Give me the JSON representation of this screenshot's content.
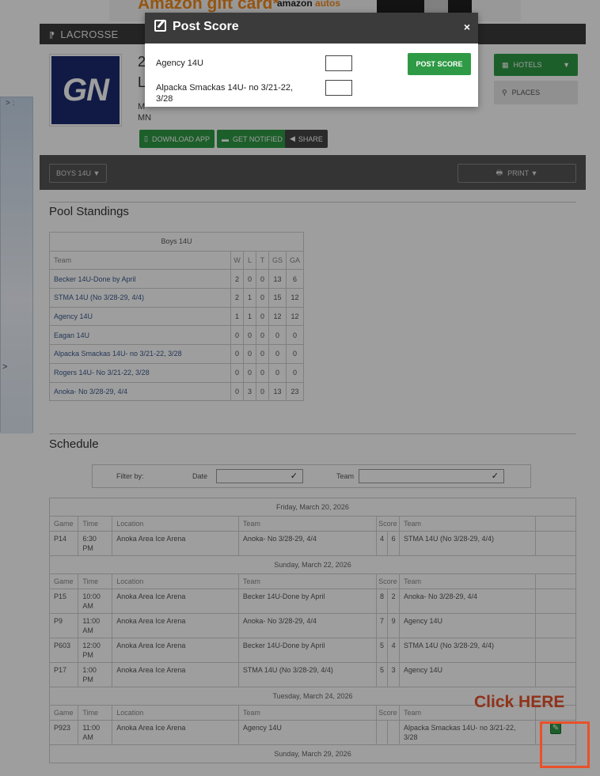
{
  "ad": {
    "brand": "Amazon gift card*",
    "sub_prefix": "amazon",
    "sub_suffix": "autos"
  },
  "sidebar_left": {
    "mark": "> :",
    "arrow": ">"
  },
  "header": {
    "title": "LACROSSE"
  },
  "team_info": {
    "logo_text": "GN",
    "name_line1": "2",
    "name_line2": "L",
    "location_line1": "M",
    "location_line2": "MN",
    "download_label": "DOWNLOAD APP",
    "notify_label": "GET NOTIFIED",
    "share_label": "SHARE",
    "hotels_label": "HOTELS",
    "places_label": "PLACES"
  },
  "toolbar": {
    "division_label": "BOYS 14U ▼",
    "print_label": "PRINT ▼"
  },
  "pool": {
    "title": "Pool Standings",
    "group": "Boys 14U",
    "columns": [
      "Team",
      "W",
      "L",
      "T",
      "GS",
      "GA"
    ],
    "rows": [
      [
        "Becker 14U-Done by April",
        "2",
        "0",
        "0",
        "13",
        "6"
      ],
      [
        "STMA 14U (No 3/28-29, 4/4)",
        "2",
        "1",
        "0",
        "15",
        "12"
      ],
      [
        "Agency 14U",
        "1",
        "1",
        "0",
        "12",
        "12"
      ],
      [
        "Eagan 14U",
        "0",
        "0",
        "0",
        "0",
        "0"
      ],
      [
        "Alpacka Smackas 14U- no 3/21-22, 3/28",
        "0",
        "0",
        "0",
        "0",
        "0"
      ],
      [
        "Rogers 14U- No 3/21-22, 3/28",
        "0",
        "0",
        "0",
        "0",
        "0"
      ],
      [
        "Anoka- No 3/28-29, 4/4",
        "0",
        "3",
        "0",
        "13",
        "23"
      ]
    ]
  },
  "schedule": {
    "title": "Schedule",
    "filter_by": "Filter by:",
    "date_label": "Date",
    "team_label": "Team",
    "columns": [
      "Game",
      "Time",
      "Location",
      "Team",
      "Score",
      "Team"
    ],
    "days": [
      {
        "date": "Friday, March 20, 2026",
        "games": [
          {
            "game": "P14",
            "time": "6:30 PM",
            "location": "Anoka Area Ice Arena",
            "home": "Anoka- No 3/28-29, 4/4",
            "s1": "4",
            "s2": "6",
            "away": "STMA 14U (No 3/28-29, 4/4)"
          }
        ]
      },
      {
        "date": "Sunday, March 22, 2026",
        "games": [
          {
            "game": "P15",
            "time": "10:00 AM",
            "location": "Anoka Area Ice Arena",
            "home": "Becker 14U-Done by April",
            "s1": "8",
            "s2": "2",
            "away": "Anoka- No 3/28-29, 4/4"
          },
          {
            "game": "P9",
            "time": "11:00 AM",
            "location": "Anoka Area Ice Arena",
            "home": "Anoka- No 3/28-29, 4/4",
            "s1": "7",
            "s2": "9",
            "away": "Agency 14U"
          },
          {
            "game": "P603",
            "time": "12:00 PM",
            "location": "Anoka Area Ice Arena",
            "home": "Becker 14U-Done by April",
            "s1": "5",
            "s2": "4",
            "away": "STMA 14U (No 3/28-29, 4/4)"
          },
          {
            "game": "P17",
            "time": "1:00 PM",
            "location": "Anoka Area Ice Arena",
            "home": "STMA 14U (No 3/28-29, 4/4)",
            "s1": "5",
            "s2": "3",
            "away": "Agency 14U"
          }
        ]
      },
      {
        "date": "Tuesday, March 24, 2026",
        "games": [
          {
            "game": "P923",
            "time": "11:00 AM",
            "location": "Anoka Area Ice Arena",
            "home": "Agency 14U",
            "s1": "",
            "s2": "",
            "away": "Alpacka Smackas 14U- no 3/21-22, 3/28",
            "edit": true
          }
        ]
      },
      {
        "date": "Sunday, March 29, 2026",
        "games": []
      }
    ]
  },
  "callout": {
    "text": "Click HERE"
  },
  "modal": {
    "title": "Post Score",
    "close": "×",
    "team1": "Agency 14U",
    "team2": "Alpacka Smackas 14U- no 3/21-22, 3/28",
    "submit_label": "POST SCORE"
  }
}
